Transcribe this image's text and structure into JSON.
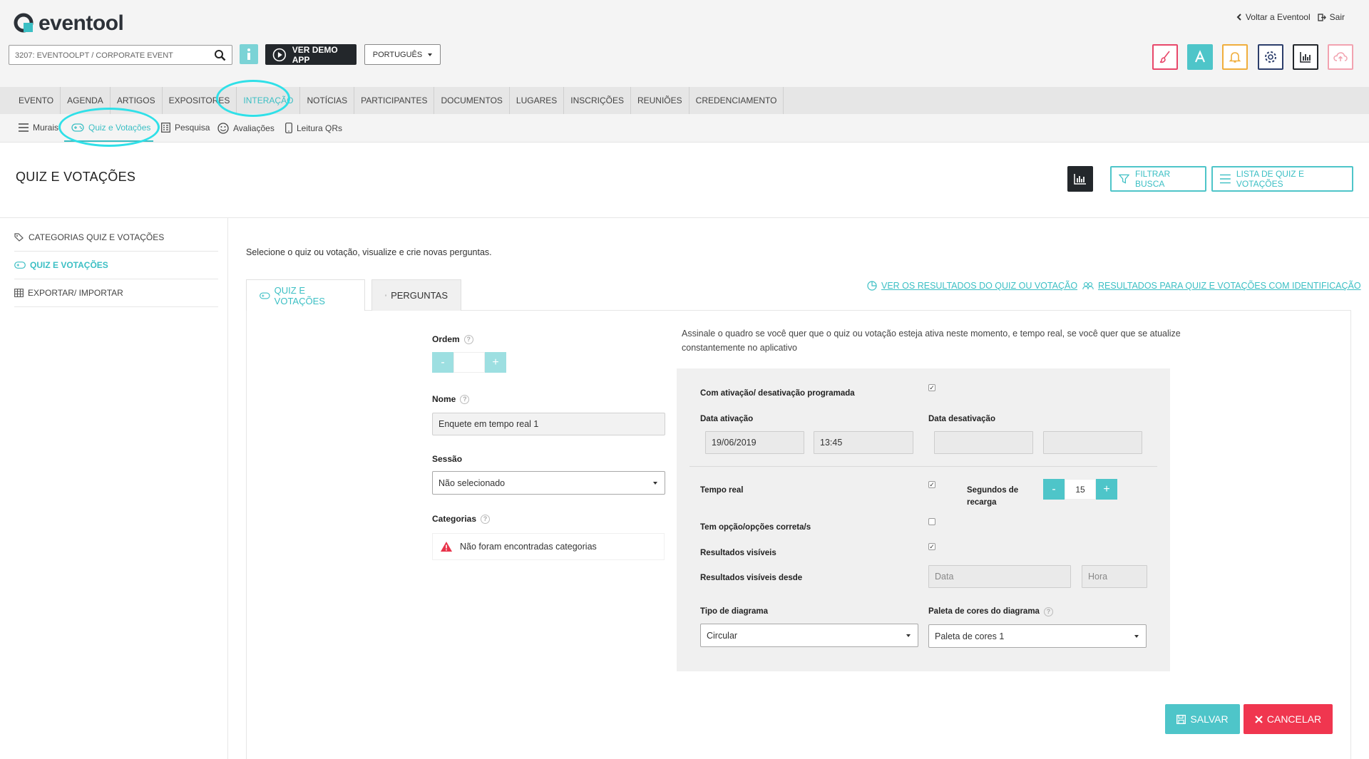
{
  "brand": {
    "name": "eventool",
    "accent": "#3bbfc4",
    "danger": "#f0364f",
    "dark": "#23272b"
  },
  "top_links": {
    "back": "Voltar a Eventool",
    "logout": "Sair"
  },
  "toolbar": {
    "event_selector": "3207: EVENTOOLPT / CORPORATE EVENT",
    "demo_label": "VER DEMO APP",
    "language": "PORTUGUÊS",
    "tool_icons": [
      "brush-icon",
      "font-icon",
      "bell-icon",
      "gear-icon",
      "chart-icon",
      "cloud-upload-icon"
    ]
  },
  "nav": {
    "items": [
      "EVENTO",
      "AGENDA",
      "ARTIGOS",
      "EXPOSITORES",
      "INTERAÇÃO",
      "NOTÍCIAS",
      "PARTICIPANTES",
      "DOCUMENTOS",
      "LUGARES",
      "INSCRIÇÕES",
      "REUNIÕES",
      "CREDENCIAMENTO"
    ],
    "active": "INTERAÇÃO"
  },
  "subnav": {
    "items": [
      "Murais",
      "Quiz e Votações",
      "Pesquisa",
      "Avaliações",
      "Leitura QRs"
    ],
    "active": "Quiz e Votações"
  },
  "page": {
    "title": "QUIZ E VOTAÇÕES",
    "filter_button": "FILTRAR BUSCA",
    "list_button": "LISTA DE QUIZ E VOTAÇÕES"
  },
  "sidebar": {
    "items": [
      "CATEGORIAS QUIZ E VOTAÇÕES",
      "QUIZ E VOTAÇÕES",
      "EXPORTAR/ IMPORTAR"
    ],
    "active": "QUIZ E VOTAÇÕES"
  },
  "main": {
    "intro": "Selecione o quiz ou votação, visualize e crie novas perguntas.",
    "tabs": [
      "QUIZ E VOTAÇÕES",
      "PERGUNTAS"
    ],
    "results_link": "VER OS RESULTADOS DO QUIZ OU VOTAÇÃO",
    "results_id_link": "RESULTADOS PARA QUIZ E VOTAÇÕES COM IDENTIFICAÇÃO"
  },
  "form": {
    "order_label": "Ordem",
    "order_minus": "-",
    "order_plus": "+",
    "order_value": "",
    "name_label": "Nome",
    "name_value": "Enquete em tempo real 1",
    "session_label": "Sessão",
    "session_value": "Não selecionado",
    "categories_label": "Categorias",
    "categories_empty": "Não foram encontradas categorias"
  },
  "settings": {
    "help_text": "Assinale o quadro se você quer que o quiz ou votação esteja ativa neste momento, e tempo real, se você quer que se atualize constantemente no aplicativo",
    "scheduled_label": "Com ativação/ desativação programada",
    "scheduled_checked": true,
    "activation_label": "Data ativação",
    "activation_date": "19/06/2019",
    "activation_time": "13:45",
    "deactivation_label": "Data desativação",
    "deactivation_date": "",
    "deactivation_time": "",
    "realtime_label": "Tempo real",
    "realtime_checked": true,
    "reload_label": "Segundos de recarga",
    "reload_minus": "-",
    "reload_plus": "+",
    "reload_seconds": "15",
    "correct_label": "Tem opção/opções correta/s",
    "correct_checked": false,
    "visible_label": "Resultados visíveis",
    "visible_checked": true,
    "visible_since_label": "Resultados visíveis desde",
    "visible_since_date_placeholder": "Data",
    "visible_since_time_placeholder": "Hora",
    "diagram_type_label": "Tipo de diagrama",
    "diagram_type_value": "Circular",
    "palette_label": "Paleta de cores do diagrama",
    "palette_value": "Paleta de cores 1"
  },
  "actions": {
    "save": "SALVAR",
    "cancel": "CANCELAR"
  }
}
